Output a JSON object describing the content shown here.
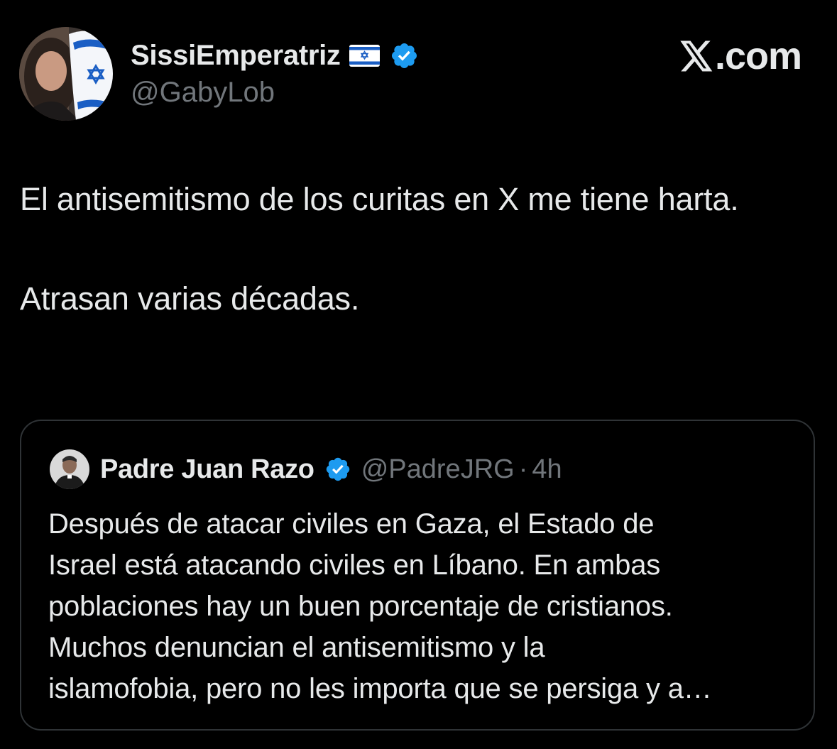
{
  "tweet": {
    "author": {
      "display_name": "SissiEmperatriz",
      "handle": "@GabyLob",
      "flag_icon": "israel-flag-icon",
      "verified": true,
      "avatar_icon": "profile-photo-with-israel-flag"
    },
    "brand": {
      "icon": "x-logo-icon",
      "text": ".com"
    },
    "text": "El antisemitismo de los curitas en X me tiene harta.\n\nAtrasan varias décadas."
  },
  "quoted_tweet": {
    "author": {
      "display_name": "Padre Juan Razo",
      "handle": "@PadreJRG",
      "verified": true,
      "avatar_icon": "priest-profile-photo"
    },
    "separator": "·",
    "time": "4h",
    "text": "Después de atacar civiles en Gaza, el Estado de\nIsrael está atacando civiles en Líbano. En ambas\npoblaciones hay un buen porcentaje de cristianos.\nMuchos denuncian el antisemitismo y la\nislamofobia, pero no les importa que se persiga y a…"
  },
  "colors": {
    "background": "#000000",
    "text_primary": "#e7e9ea",
    "text_secondary": "#71767b",
    "border": "#2f3336",
    "verified_blue": "#1d9bf0"
  }
}
